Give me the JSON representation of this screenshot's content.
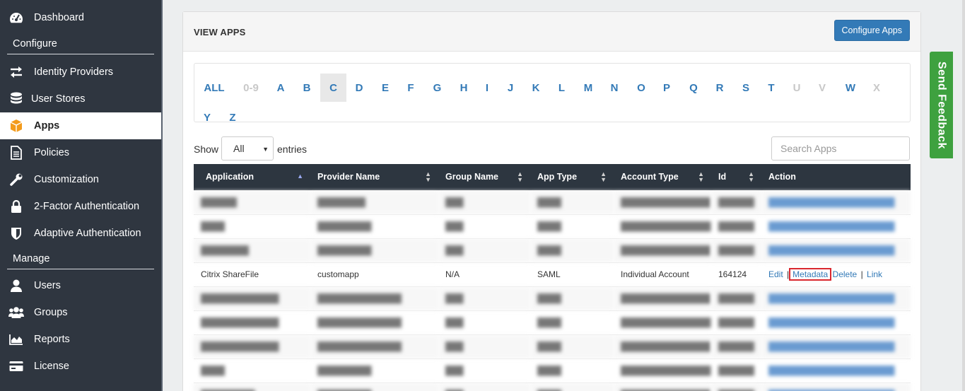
{
  "sidebar": {
    "items": [
      {
        "label": "Dashboard",
        "icon": "dashboard-icon"
      },
      {
        "label": "Identity Providers",
        "icon": "exchange-icon"
      },
      {
        "label": "User Stores",
        "icon": "database-icon"
      },
      {
        "label": "Apps",
        "icon": "cube-icon"
      },
      {
        "label": "Policies",
        "icon": "document-icon"
      },
      {
        "label": "Customization",
        "icon": "wrench-icon"
      },
      {
        "label": "2-Factor Authentication",
        "icon": "lock-icon"
      },
      {
        "label": "Adaptive Authentication",
        "icon": "shield-icon"
      },
      {
        "label": "Users",
        "icon": "user-icon"
      },
      {
        "label": "Groups",
        "icon": "users-icon"
      },
      {
        "label": "Reports",
        "icon": "area-chart-icon"
      },
      {
        "label": "License",
        "icon": "card-icon"
      }
    ],
    "sections": {
      "configure": "Configure",
      "manage": "Manage"
    },
    "active": "Apps"
  },
  "header": {
    "title": "VIEW APPS",
    "configure_button": "Configure Apps"
  },
  "alphabet": {
    "row1": [
      "ALL",
      "0-9",
      "A",
      "B",
      "C",
      "D",
      "E",
      "F",
      "G",
      "H",
      "I",
      "J",
      "K",
      "L",
      "M",
      "N",
      "O",
      "P",
      "Q",
      "R",
      "S",
      "T",
      "U",
      "V",
      "W",
      "X"
    ],
    "row2": [
      "Y",
      "Z"
    ],
    "disabled": [
      "0-9",
      "U",
      "V",
      "X"
    ],
    "selected": "C"
  },
  "controls": {
    "show_label": "Show",
    "entries_value": "All",
    "entries_label": "entries",
    "search_placeholder": "Search Apps"
  },
  "table": {
    "columns": [
      "Application",
      "Provider Name",
      "Group Name",
      "App Type",
      "Account Type",
      "Id",
      "Action"
    ],
    "rows": [
      {
        "app": "Citrix ShareFile",
        "provider": "customapp",
        "group": "N/A",
        "type": "SAML",
        "account": "Individual Account",
        "id": "164124"
      }
    ],
    "actions": {
      "edit": "Edit",
      "metadata": "Metadata",
      "delete": "Delete",
      "link": "Link",
      "separator": "|"
    }
  },
  "feedback": {
    "label": "Send Feedback"
  },
  "colors": {
    "sidebar_bg": "#2f3640",
    "accent": "#337ab7",
    "feedback": "#3ea13f",
    "highlight_box": "#d9272e"
  }
}
